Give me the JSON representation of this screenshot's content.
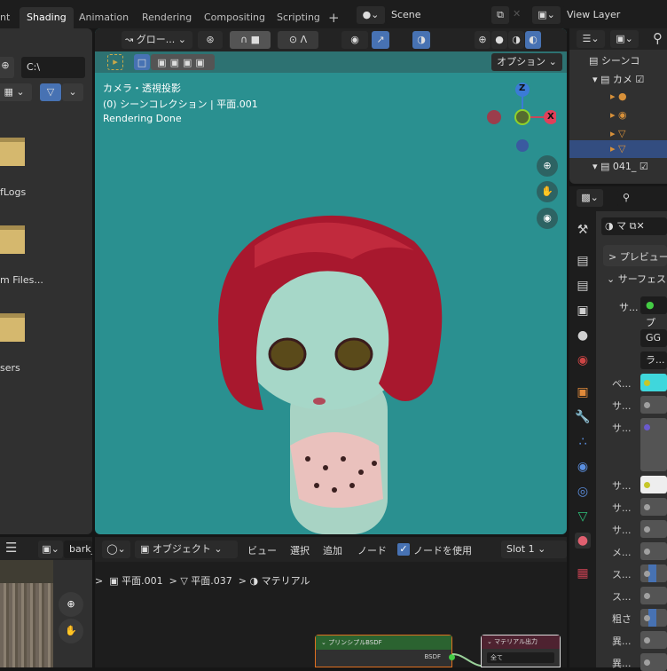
{
  "topbar": {
    "tabs": [
      "nt",
      "Shading",
      "Animation",
      "Rendering",
      "Compositing",
      "Scripting"
    ],
    "add_tab": "+",
    "scene": "Scene",
    "view_layer": "View Layer"
  },
  "filebrowser": {
    "path": "C:\\",
    "folders": [
      "fLogs",
      "m Files...",
      "sers"
    ]
  },
  "viewport": {
    "orientation": "グロー...",
    "options": "オプション",
    "overlay_line1": "カメラ・透視投影",
    "overlay_line2": "(0) シーンコレクション | 平面.001",
    "overlay_line3": "Rendering Done",
    "axis_z": "Z",
    "axis_x": "X",
    "bg_color": "#2a9090"
  },
  "outliner": {
    "root": "シーンコ",
    "collection1": "カメ",
    "collection2": "041_"
  },
  "properties": {
    "material_name": "マ",
    "preview": "プレビュー",
    "surface": "サーフェス",
    "surface_shader": "プ",
    "rows": [
      {
        "label": "サ...",
        "value": ""
      },
      {
        "label": "",
        "value": "GG"
      },
      {
        "label": "",
        "value": "ラ..."
      },
      {
        "label": "ベ...",
        "color": "#3fd7dc"
      },
      {
        "label": "サ...",
        "color": ""
      },
      {
        "label": "サ...",
        "color": ""
      },
      {
        "label": "サ...",
        "color": "#eeeeee"
      },
      {
        "label": "サ...",
        "color": ""
      },
      {
        "label": "サ...",
        "color": ""
      },
      {
        "label": "メ...",
        "color": ""
      },
      {
        "label": "ス...",
        "color": "#4772b3"
      },
      {
        "label": "ス...",
        "color": ""
      },
      {
        "label": "粗さ",
        "color": "#4772b3"
      },
      {
        "label": "異...",
        "color": ""
      },
      {
        "label": "異...",
        "color": ""
      }
    ]
  },
  "image_editor": {
    "image_name": "bark_"
  },
  "node_editor": {
    "mode": "オブジェクト",
    "menu": [
      "ビュー",
      "選択",
      "追加",
      "ノード"
    ],
    "use_nodes": "ノードを使用",
    "use_nodes_checked": true,
    "slot": "Slot 1",
    "breadcrumb": [
      "平面.001",
      "平面.037",
      "マテリアル"
    ],
    "node_bsdf": {
      "title": "プリンシプルBSDF",
      "output": "BSDF"
    },
    "node_output": {
      "title": "マテリアル出力",
      "target": "全て"
    }
  }
}
